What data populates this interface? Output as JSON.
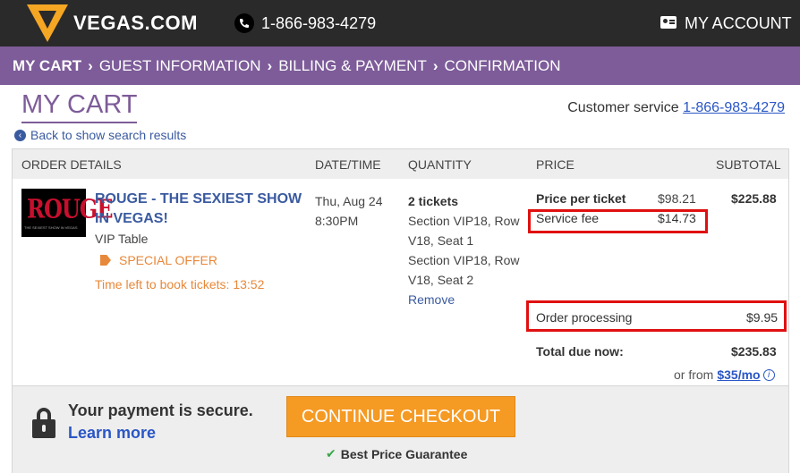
{
  "header": {
    "logo_text": "VEGAS.COM",
    "phone": "1-866-983-4279",
    "account_label": "MY ACCOUNT"
  },
  "breadcrumb": {
    "steps": [
      "MY CART",
      "GUEST INFORMATION",
      "BILLING & PAYMENT",
      "CONFIRMATION"
    ],
    "active_index": 0
  },
  "page": {
    "title": "MY CART",
    "customer_service_label": "Customer service",
    "customer_service_phone": "1-866-983-4279",
    "back_link": "Back to show search results"
  },
  "table": {
    "headers": [
      "ORDER DETAILS",
      "DATE/TIME",
      "QUANTITY",
      "PRICE",
      "SUBTOTAL"
    ],
    "item": {
      "thumb_title": "ROUGE",
      "thumb_subtitle": "THE SEXIEST SHOW IN VEGAS",
      "show_title": "ROUGE - THE SEXIEST SHOW IN VEGAS!",
      "package": "VIP Table",
      "offer": "SPECIAL OFFER",
      "time_left": "Time left to book tickets: 13:52",
      "date": "Thu, Aug 24",
      "time": "8:30PM",
      "quantity": "2 tickets",
      "seat1": "Section VIP18, Row V18, Seat 1",
      "seat2": "Section VIP18, Row V18, Seat 2",
      "remove_label": "Remove",
      "price_per_ticket_label": "Price per ticket",
      "price_per_ticket": "$98.21",
      "service_fee_label": "Service fee",
      "service_fee": "$14.73",
      "subtotal": "$225.88"
    },
    "order_processing_label": "Order processing",
    "order_processing": "$9.95",
    "total_label": "Total due now:",
    "total": "$235.83",
    "financing_prefix": "or from",
    "financing_amount": "$35/mo"
  },
  "footer": {
    "secure_text": "Your payment is secure.",
    "learn_more": "Learn more",
    "checkout_button": "CONTINUE CHECKOUT",
    "guarantee": "Best Price Guarantee"
  },
  "colors": {
    "header_bg": "#2a2a2a",
    "brand_purple": "#7d5c99",
    "link_blue": "#2a56c6",
    "offer_orange": "#e8883a",
    "checkout_orange": "#f59a23",
    "highlight_red": "#e01010"
  }
}
